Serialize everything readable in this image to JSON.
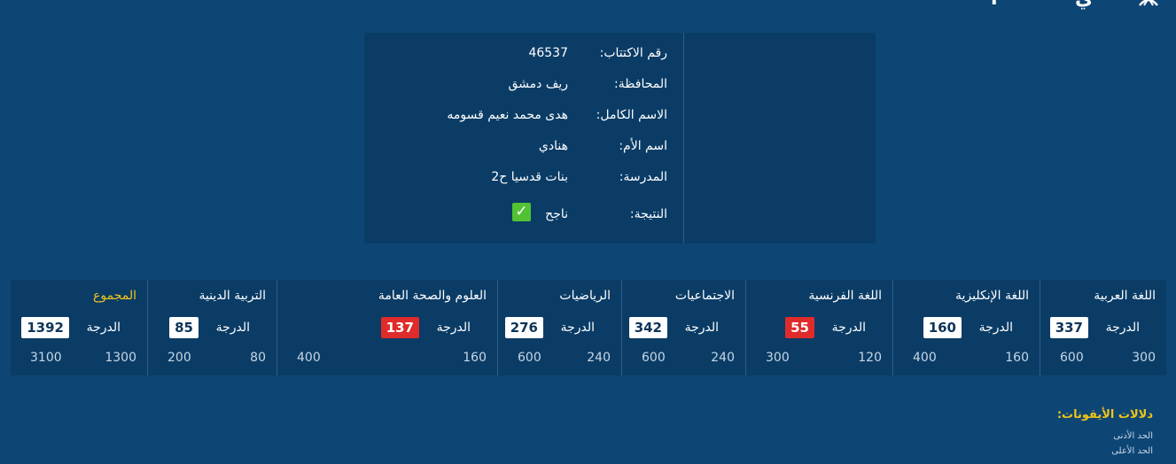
{
  "header": {
    "glyph_a": "ا",
    "glyph_b": "ي"
  },
  "student": {
    "exam_number": {
      "label": "رقم الاكتتاب:",
      "value": "46537"
    },
    "governorate": {
      "label": "المحافظة:",
      "value": "ريف دمشق"
    },
    "full_name": {
      "label": "الاسم الكامل:",
      "value": "هدى محمد نعيم قسومه"
    },
    "mother_name": {
      "label": "اسم الأم:",
      "value": "هنادي"
    },
    "school": {
      "label": "المدرسة:",
      "value": "بنات قدسيا ح2"
    },
    "result": {
      "label": "النتيجة:",
      "value": "ناجح",
      "icon": "check-icon"
    }
  },
  "grades": {
    "grade_label": "الدرجة",
    "subjects": [
      {
        "name": "اللغة العربية",
        "score": "337",
        "min": "300",
        "max": "600",
        "fail": false
      },
      {
        "name": "اللغة الإنكليزية",
        "score": "160",
        "min": "160",
        "max": "400",
        "fail": false
      },
      {
        "name": "اللغة الفرنسية",
        "score": "55",
        "min": "120",
        "max": "300",
        "fail": true
      },
      {
        "name": "الاجتماعيات",
        "score": "342",
        "min": "240",
        "max": "600",
        "fail": false
      },
      {
        "name": "الرياضيات",
        "score": "276",
        "min": "240",
        "max": "600",
        "fail": false
      },
      {
        "name": "العلوم والصحة العامة",
        "score": "137",
        "min": "160",
        "max": "400",
        "fail": true
      },
      {
        "name": "التربية الدينية",
        "score": "85",
        "min": "80",
        "max": "200",
        "fail": false
      },
      {
        "name": "المجموع",
        "score": "1392",
        "min": "1300",
        "max": "3100",
        "fail": false
      }
    ]
  },
  "legend": {
    "title": "دلالات الأيقونات:",
    "items": [
      "الحد الأدنى",
      "الحد الأعلى"
    ]
  },
  "colors": {
    "background": "#0d4675",
    "panel": "#0a3c66",
    "fail": "#e02b2b",
    "pass": "#52c234",
    "total_label": "#f0c419"
  }
}
